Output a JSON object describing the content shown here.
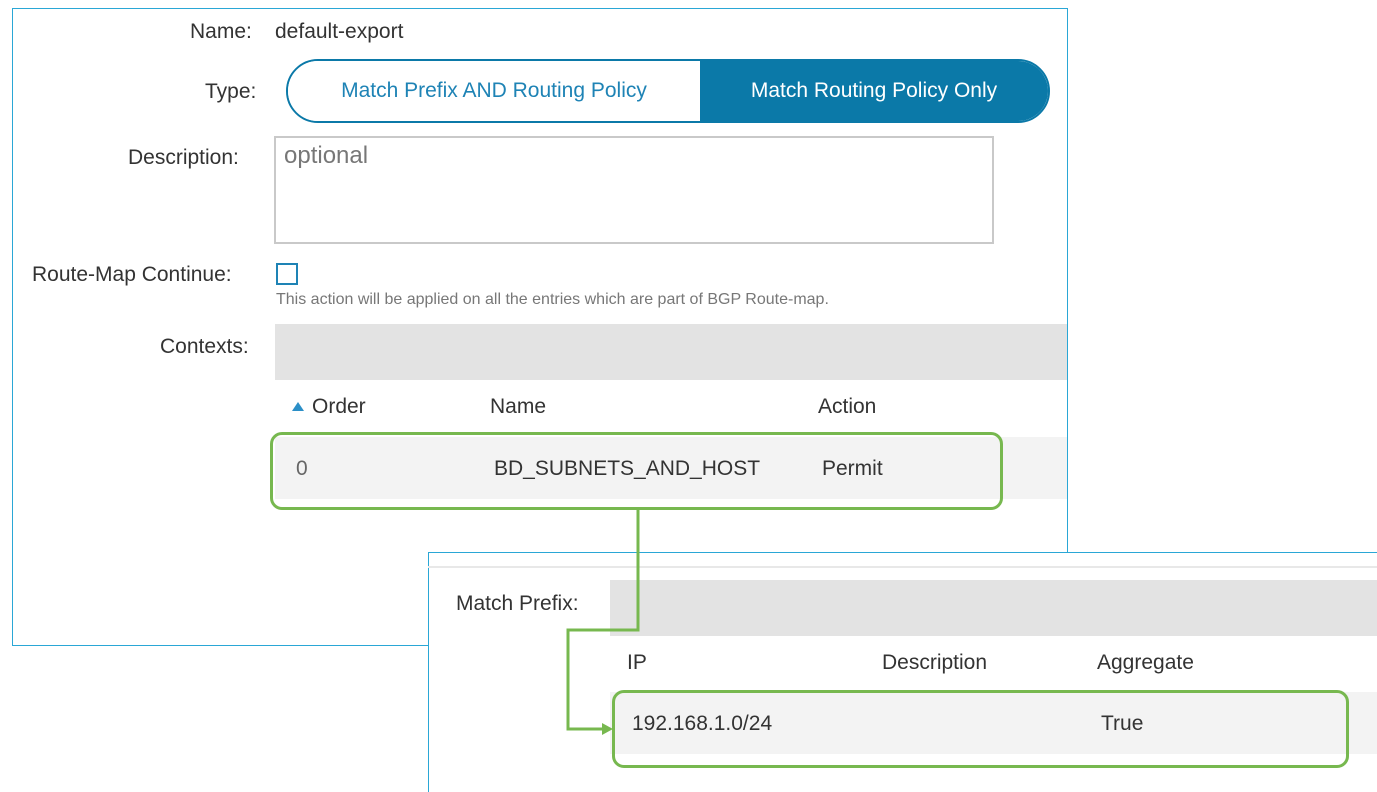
{
  "form": {
    "name_label": "Name:",
    "name_value": "default-export",
    "type_label": "Type:",
    "type_options": [
      "Match Prefix AND Routing Policy",
      "Match Routing Policy Only"
    ],
    "type_selected": "Match Routing Policy Only",
    "description_label": "Description:",
    "description_placeholder": "optional",
    "route_map_continue_label": "Route-Map Continue:",
    "route_map_continue_checked": false,
    "route_map_continue_hint": "This action will be applied on all the entries which are part of BGP Route-map.",
    "contexts_label": "Contexts:"
  },
  "contexts_table": {
    "columns": [
      "Order",
      "Name",
      "Action"
    ],
    "rows": [
      {
        "order": "0",
        "name": "BD_SUBNETS_AND_HOST",
        "action": "Permit"
      }
    ]
  },
  "match_prefix": {
    "label": "Match Prefix:",
    "columns": [
      "IP",
      "Description",
      "Aggregate"
    ],
    "rows": [
      {
        "ip": "192.168.1.0/24",
        "description": "",
        "aggregate": "True"
      }
    ]
  },
  "colors": {
    "accent": "#0b79a8",
    "panel_border": "#2aa7d6",
    "highlight": "#77b84f"
  }
}
